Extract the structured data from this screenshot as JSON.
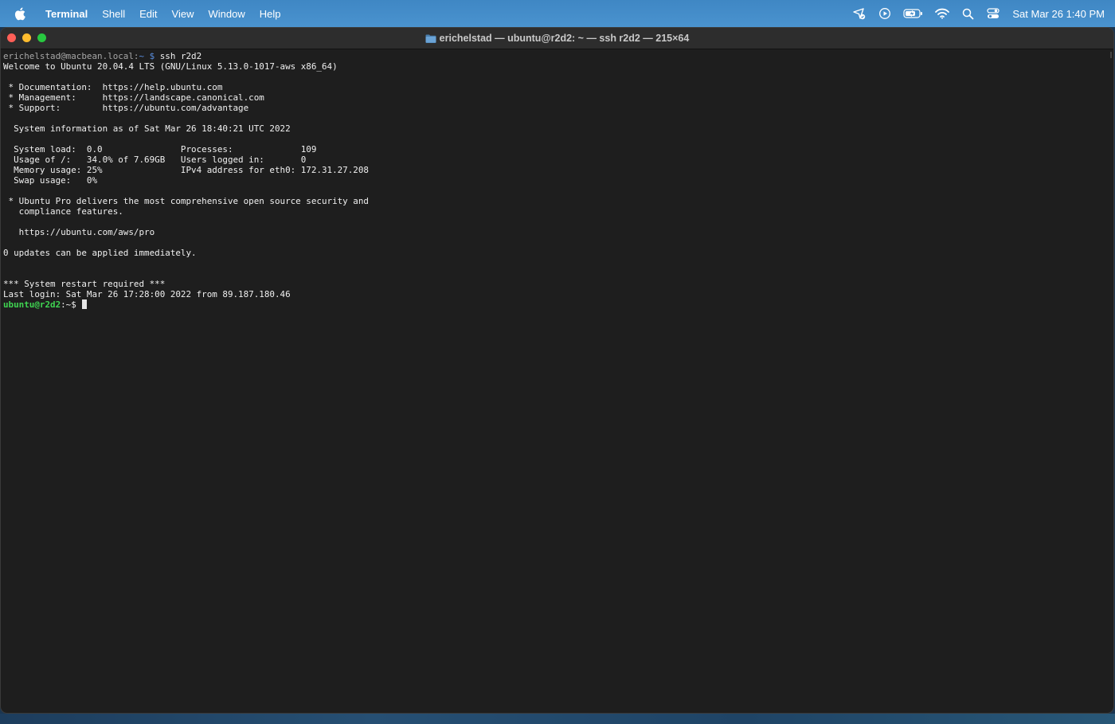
{
  "menubar": {
    "app_name": "Terminal",
    "items": [
      "Shell",
      "Edit",
      "View",
      "Window",
      "Help"
    ],
    "clock": "Sat Mar 26  1:40 PM",
    "icons": [
      "apple-icon",
      "location-icon",
      "play-icon",
      "battery-icon",
      "wifi-icon",
      "search-icon",
      "control-center-icon"
    ]
  },
  "window": {
    "title": "erichelstad — ubuntu@r2d2: ~ — ssh r2d2 — 215×64"
  },
  "terminal": {
    "prompt_local": "erichelstad@macbean.local:",
    "prompt_local_path": "~",
    "prompt_local_symbol": " $ ",
    "command": "ssh r2d2",
    "lines": [
      "Welcome to Ubuntu 20.04.4 LTS (GNU/Linux 5.13.0-1017-aws x86_64)",
      "",
      " * Documentation:  https://help.ubuntu.com",
      " * Management:     https://landscape.canonical.com",
      " * Support:        https://ubuntu.com/advantage",
      "",
      "  System information as of Sat Mar 26 18:40:21 UTC 2022",
      "",
      "  System load:  0.0               Processes:             109",
      "  Usage of /:   34.0% of 7.69GB   Users logged in:       0",
      "  Memory usage: 25%               IPv4 address for eth0: 172.31.27.208",
      "  Swap usage:   0%",
      "",
      " * Ubuntu Pro delivers the most comprehensive open source security and",
      "   compliance features.",
      "",
      "   https://ubuntu.com/aws/pro",
      "",
      "0 updates can be applied immediately.",
      "",
      "",
      "*** System restart required ***",
      "Last login: Sat Mar 26 17:28:00 2022 from 89.187.180.46"
    ],
    "prompt_remote_user": "ubuntu@r2d2",
    "prompt_remote_path": ":~",
    "prompt_remote_symbol": "$"
  },
  "colors": {
    "menubar": "#4a93cf",
    "terminal_bg": "#1e1e1e",
    "prompt_green": "#3fd451",
    "close": "#ff5f57",
    "minimize": "#febc2e",
    "maximize": "#28c840"
  }
}
